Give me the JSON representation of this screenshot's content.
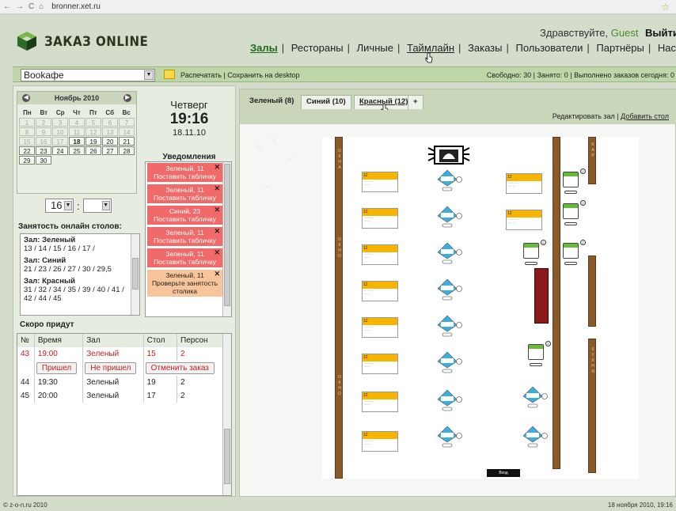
{
  "browser": {
    "url": "bronner.xet.ru"
  },
  "header": {
    "logo_text": "ЗАКАЗ ONLINE",
    "greeting": "Здравствуйте,",
    "user": "Guest",
    "exit": "Выйти",
    "nav": [
      "Залы",
      "Рестораны",
      "Личные",
      "Таймлайн",
      "Заказы",
      "Пользователи",
      "Партнёры",
      "Настройки"
    ]
  },
  "toolbar": {
    "restaurant": "Bookафе",
    "print": "Распечатать",
    "save": "Сохранить на desktop",
    "status": "Свободно: 30  |  Занято: 0  |  Выполнено заказов сегодня: 0"
  },
  "calendar": {
    "month": "Ноябрь 2010",
    "dow": [
      "Пн",
      "Вт",
      "Ср",
      "Чт",
      "Пт",
      "Сб",
      "Вс"
    ],
    "weeks": [
      [
        "1",
        "2",
        "3",
        "4",
        "5",
        "6",
        "7"
      ],
      [
        "8",
        "9",
        "10",
        "11",
        "12",
        "13",
        "14"
      ],
      [
        "15",
        "16",
        "17",
        "18",
        "19",
        "20",
        "21"
      ],
      [
        "22",
        "23",
        "24",
        "25",
        "26",
        "27",
        "28"
      ],
      [
        "29",
        "30",
        "",
        "",
        "",
        "",
        ""
      ]
    ]
  },
  "clock": {
    "weekday": "Четверг",
    "time": "19:16",
    "date": "18.11.10"
  },
  "time_select": {
    "hour": "16",
    "minute": ""
  },
  "occupancy": {
    "title": "Занятость онлайн столов:",
    "halls": [
      {
        "name": "Зал: Зеленый",
        "tables": "13 / 14 / 15 / 16 / 17 /"
      },
      {
        "name": "Зал: Синий",
        "tables": "21 / 23 / 26 / 27 / 30 / 29,5"
      },
      {
        "name": "Зал: Красный",
        "tables": "31 / 32 / 34 / 35 / 39 / 40 / 41 / 42 / 44 / 45"
      }
    ]
  },
  "notifications": {
    "title": "Уведомления",
    "items": [
      {
        "line1": "Зеленый, 11",
        "line2": "Поставить табличку"
      },
      {
        "line1": "Зеленый, 11",
        "line2": "Поставить табличку"
      },
      {
        "line1": "Синий, 23",
        "line2": "Поставить табличку"
      },
      {
        "line1": "Зеленый, 11",
        "line2": "Поставить табличку"
      },
      {
        "line1": "Зеленый, 11",
        "line2": "Поставить табличку"
      },
      {
        "line1": "Зеленый, 11",
        "line2": "Проверьте занятость столика"
      }
    ]
  },
  "soon": {
    "title": "Скоро придут",
    "headers": [
      "№",
      "Время",
      "Зал",
      "Стол",
      "Персон"
    ],
    "rows": [
      [
        "43",
        "19:00",
        "Зеленый",
        "15",
        "2"
      ],
      [
        "44",
        "19:30",
        "Зеленый",
        "19",
        "2"
      ],
      [
        "45",
        "20:00",
        "Зеленый",
        "17",
        "2"
      ]
    ],
    "btn_came": "Пришел",
    "btn_notcame": "Не пришел",
    "btn_cancel": "Отменить заказ"
  },
  "tabs": [
    "Зеленый (8)",
    "Синий (10)",
    "Красный (12)",
    "+"
  ],
  "edit": {
    "edit_hall": "Редактировать зал",
    "add_table": "Добавить стол"
  },
  "plan": {
    "entry": "Вход",
    "window_label": "ОКНА",
    "window_label2": "ОКНО",
    "bar_label": "БАР",
    "kitchen_label": "КУХНЯ",
    "table_num": "12"
  },
  "footer": {
    "copyright": "© z-o-n.ru 2010",
    "date": "18 ноября 2010, 19:16"
  }
}
